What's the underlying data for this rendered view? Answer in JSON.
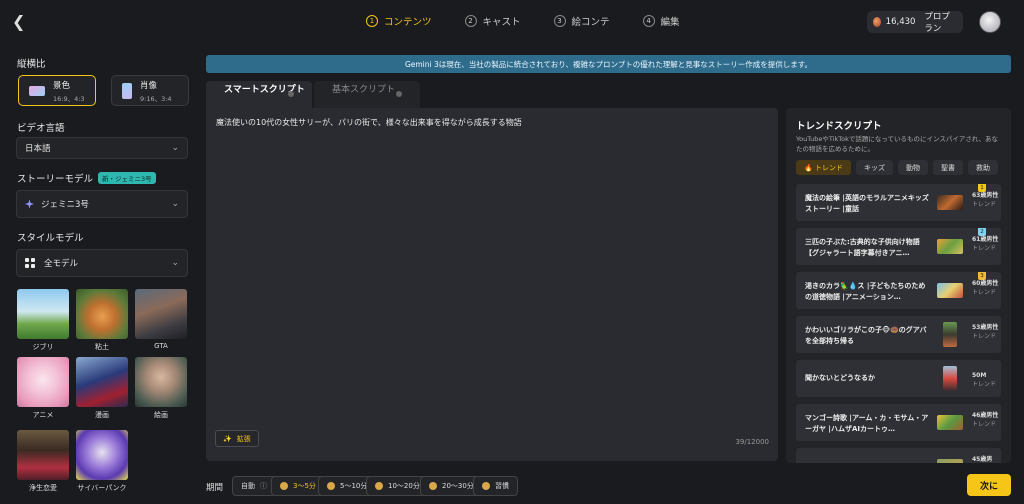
{
  "header": {
    "steps": [
      {
        "num": "1",
        "label": "コンテンツ"
      },
      {
        "num": "2",
        "label": "キャスト"
      },
      {
        "num": "3",
        "label": "絵コンテ"
      },
      {
        "num": "4",
        "label": "編集"
      }
    ],
    "credits": "16,430",
    "plan": "プロプラン"
  },
  "sidebar": {
    "aspect_label": "縦横比",
    "aspect_options": [
      {
        "title": "景色",
        "sub": "16:9、4:3"
      },
      {
        "title": "肖像",
        "sub": "9:16、3:4"
      }
    ],
    "language_label": "ビデオ言語",
    "language_value": "日本語",
    "story_label": "ストーリーモデル",
    "story_badge": "新・ジェミニ3号",
    "story_value": "ジェミニ3号",
    "style_label": "スタイルモデル",
    "style_value": "全モデル",
    "styles": [
      "ジブリ",
      "粘土",
      "GTA",
      "アニメ",
      "漫画",
      "絵画",
      "浄生恋愛",
      "サイバーパンク"
    ]
  },
  "banner": "Gemini 3は現在、当社の製品に統合されており、複雑なプロンプトの優れた理解と見事なストーリー作成を提供します。",
  "tabs": [
    "スマートスクリプト",
    "基本スクリプト"
  ],
  "editor": {
    "text": "魔法使いの10代の女性サリーが、パリの街で、様々な出来事を得ながら成長する物語",
    "expand": "拡張",
    "counter": "39/12000"
  },
  "trend": {
    "title": "トレンドスクリプト",
    "description": "YouTubeやTikTokで話題になっているものにインスパイアされ、あなたの物語を広めるために。",
    "chips": [
      "🔥 トレンド",
      "キッズ",
      "動物",
      "聖書",
      "救助"
    ],
    "items": [
      {
        "title": "魔法の絵筆 |英語のモラルアニメキッズストーリー |童話",
        "stat": "63歳男性",
        "sub": "トレンド",
        "rank": "1",
        "rank_color": "#f5c518"
      },
      {
        "title": "三匹の子ぶた:古典的な子供向け物語【グジャラート語字幕付きアニ…",
        "stat": "61歳男性",
        "sub": "トレンド",
        "rank": "2",
        "rank_color": "#7fd3f0"
      },
      {
        "title": "渇きのカラ🦜💧ス |子どもたちのための道徳物語 |アニメーション…",
        "stat": "60歳男性",
        "sub": "トレンド",
        "rank": "3",
        "rank_color": "#f5b73a"
      },
      {
        "title": "かわいいゴリラがこの子🐵🍩のグアバを全部持ち帰る",
        "stat": "53歳男性",
        "sub": "トレンド",
        "rank": "",
        "rank_color": ""
      },
      {
        "title": "聞かないとどうなるか",
        "stat": "50M",
        "sub": "トレンド",
        "rank": "",
        "rank_color": ""
      },
      {
        "title": "マンゴー詩歌 |アーム・カ・モサム・アーガヤ |ハムザAIカートゥ…",
        "stat": "46歳男性",
        "sub": "トレンド",
        "rank": "",
        "rank_color": ""
      },
      {
        "title": "",
        "stat": "45歳男",
        "sub": "",
        "rank": "",
        "rank_color": ""
      }
    ]
  },
  "bottom": {
    "period_label": "期間",
    "durations": [
      "自動",
      "3〜5分",
      "5〜10分",
      "10〜20分",
      "20〜30分",
      "習慣"
    ],
    "next": "次に"
  },
  "colors": {
    "accent": "#f5c518",
    "banner": "#2f6c8c",
    "background": "#1a1b1f"
  }
}
